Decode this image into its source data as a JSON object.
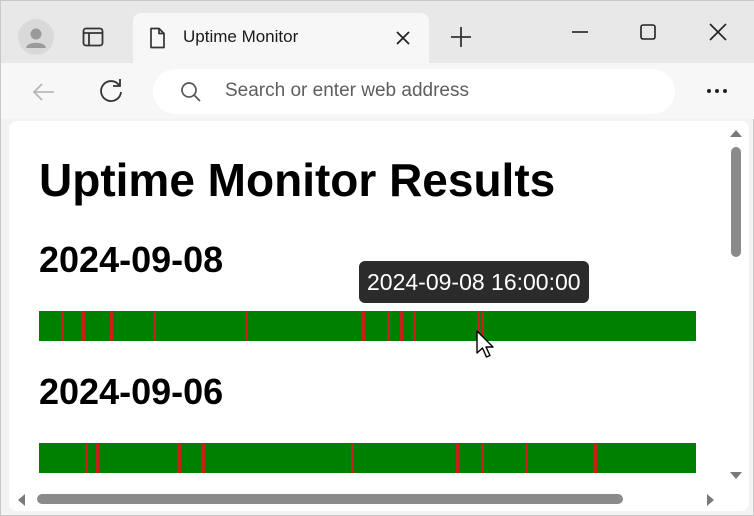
{
  "browser": {
    "tab_title": "Uptime Monitor",
    "address_placeholder": "Search or enter web address"
  },
  "page": {
    "heading": "Uptime Monitor Results",
    "days": [
      {
        "date": "2024-09-08",
        "outage_marks": [
          0.034,
          0.066,
          0.108,
          0.173,
          0.313,
          0.491,
          0.529,
          0.549,
          0.569,
          0.667,
          0.672
        ]
      },
      {
        "date": "2024-09-06",
        "outage_marks": [
          0.07,
          0.087,
          0.211,
          0.248,
          0.475,
          0.635,
          0.673,
          0.74,
          0.845
        ]
      }
    ],
    "tooltip": "2024-09-08 16:00:00"
  },
  "colors": {
    "up": "#008000",
    "down": "#c81e1e"
  },
  "icons": {
    "profile": "profile-icon",
    "tabs": "tab-actions-icon",
    "page": "page-icon",
    "close_tab": "close-icon",
    "new_tab": "plus-icon",
    "back": "back-arrow-icon",
    "reload": "reload-icon",
    "search": "search-icon",
    "menu": "more-icon"
  }
}
